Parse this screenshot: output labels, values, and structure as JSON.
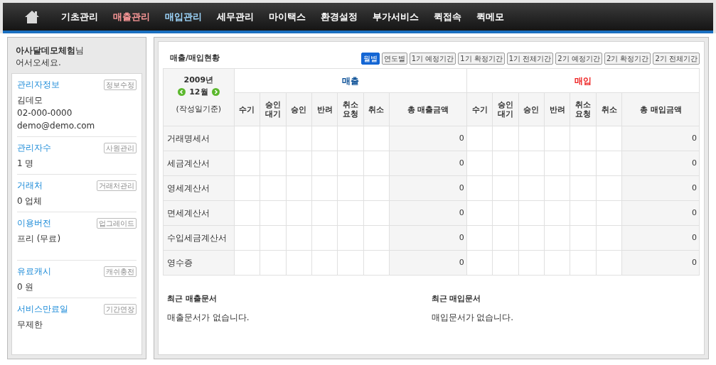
{
  "nav": {
    "items": [
      {
        "label": "기초관리",
        "color": "#ffffff"
      },
      {
        "label": "매출관리",
        "color": "#ff9a9a"
      },
      {
        "label": "매입관리",
        "color": "#9fd8ff"
      },
      {
        "label": "세무관리",
        "color": "#ffffff"
      },
      {
        "label": "마이택스",
        "color": "#ffffff"
      },
      {
        "label": "환경설정",
        "color": "#ffffff"
      },
      {
        "label": "부가서비스",
        "color": "#ffffff"
      },
      {
        "label": "퀵접속",
        "color": "#ffffff"
      },
      {
        "label": "퀵메모",
        "color": "#ffffff"
      }
    ]
  },
  "sidebar": {
    "greeting_name": "아사달데모체험",
    "greeting_suffix": "님",
    "greeting_line2": "어서오세요.",
    "sections": [
      {
        "title": "관리자정보",
        "button": "정보수정",
        "lines": [
          "김데모",
          "02-000-0000",
          "demo@demo.com"
        ]
      },
      {
        "title": "관리자수",
        "button": "사원관리",
        "lines": [
          "1 명"
        ]
      },
      {
        "title": "거래처",
        "button": "거래처관리",
        "lines": [
          "0 업체"
        ]
      },
      {
        "title": "이용버전",
        "button": "업그레이드",
        "lines": [
          "프리 (무료)"
        ]
      },
      {
        "title": "유료캐시",
        "button": "캐쉬충전",
        "lines": [
          "0 원"
        ]
      },
      {
        "title": "서비스만료일",
        "button": "기간연장",
        "lines": [
          "무제한"
        ]
      }
    ]
  },
  "main": {
    "title": "매출/매입현황",
    "periods": [
      {
        "label": "월별",
        "selected": true
      },
      {
        "label": "연도별",
        "selected": false
      },
      {
        "label": "1기 예정기간",
        "selected": false
      },
      {
        "label": "1기 확정기간",
        "selected": false
      },
      {
        "label": "1기 전체기간",
        "selected": false
      },
      {
        "label": "2기 예정기간",
        "selected": false
      },
      {
        "label": "2기 확정기간",
        "selected": false
      },
      {
        "label": "2기 전체기간",
        "selected": false
      }
    ],
    "table": {
      "year": "2009년",
      "month": "12월",
      "basis": "(작성일기준)",
      "groups": [
        {
          "label": "매출",
          "color": "#0a4f96",
          "columns": [
            "수기",
            "승인\n대기",
            "승인",
            "반려",
            "취소\n요청",
            "취소",
            "총 매출금액"
          ]
        },
        {
          "label": "매입",
          "color": "#ee2222",
          "columns": [
            "수기",
            "승인\n대기",
            "승인",
            "반려",
            "취소\n요청",
            "취소",
            "총 매입금액"
          ]
        }
      ],
      "rows": [
        {
          "label": "거래명세서",
          "sales_total": "0",
          "purchase_total": "0"
        },
        {
          "label": "세금계산서",
          "sales_total": "0",
          "purchase_total": "0"
        },
        {
          "label": "영세계산서",
          "sales_total": "0",
          "purchase_total": "0"
        },
        {
          "label": "면세계산서",
          "sales_total": "0",
          "purchase_total": "0"
        },
        {
          "label": "수입세금계산서",
          "sales_total": "0",
          "purchase_total": "0"
        },
        {
          "label": "영수증",
          "sales_total": "0",
          "purchase_total": "0"
        }
      ]
    },
    "recent": [
      {
        "title": "최근 매출문서",
        "message": "매출문서가 없습니다."
      },
      {
        "title": "최근 매입문서",
        "message": "매입문서가 없습니다."
      }
    ]
  }
}
